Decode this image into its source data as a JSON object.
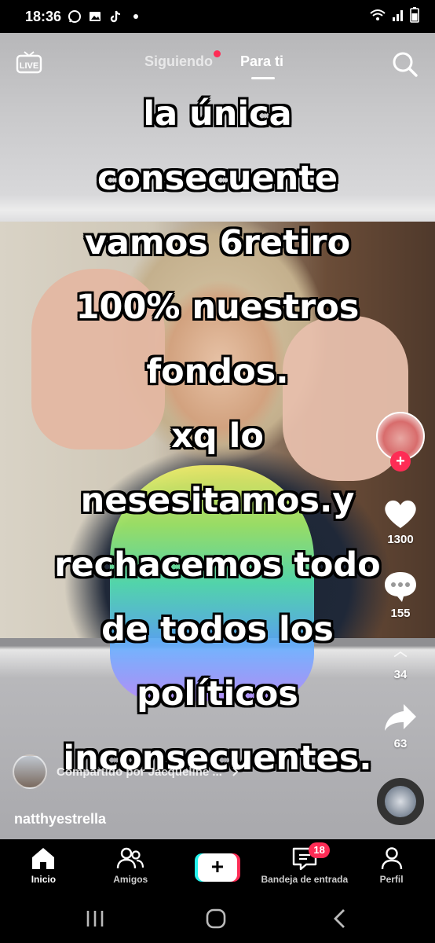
{
  "status_bar": {
    "time": "18:36",
    "notification_icons": [
      "whatsapp-icon",
      "gallery-icon",
      "tiktok-icon",
      "dot-icon"
    ],
    "system_icons": [
      "wifi-icon",
      "signal-icon",
      "battery-icon"
    ]
  },
  "top_nav": {
    "live_label": "LIVE",
    "tab_following": "Siguiendo",
    "tab_for_you": "Para ti",
    "active_tab": "Para ti",
    "following_has_dot": true
  },
  "video": {
    "caption_lines": [
      "la única",
      "consecuente",
      "vamos 6retiro",
      "100% nuestros",
      "fondos.",
      "xq lo",
      "nesesitamos.y",
      "rechacemos todo",
      "de todos los",
      "políticos",
      "inconsecuentes."
    ]
  },
  "actions": {
    "likes": "1300",
    "comments": "155",
    "saves": "34",
    "shares": "63"
  },
  "info": {
    "shared_by": "Compartido por Jacqueline ...",
    "username": "natthyestrella"
  },
  "tab_bar": {
    "home": "Inicio",
    "friends": "Amigos",
    "create_label": "+",
    "inbox": "Bandeja de entrada",
    "inbox_badge": "18",
    "profile": "Perfil"
  },
  "colors": {
    "accent_red": "#fe2c55",
    "accent_cyan": "#25f4ee",
    "background": "#000000"
  }
}
